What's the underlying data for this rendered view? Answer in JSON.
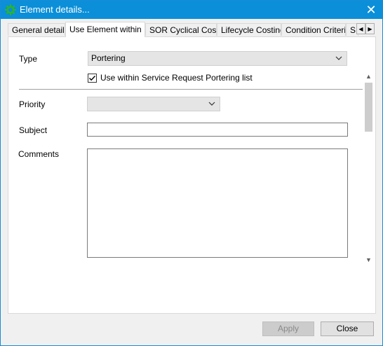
{
  "window": {
    "title": "Element details...",
    "close_glyph": "✕"
  },
  "tabs": [
    {
      "label": "General details",
      "active": false
    },
    {
      "label": "Use Element within ..",
      "active": true
    },
    {
      "label": "SOR Cyclical Costs",
      "active": false
    },
    {
      "label": "Lifecycle Costing",
      "active": false
    },
    {
      "label": "Condition Criteria",
      "active": false
    },
    {
      "label": "S",
      "active": false
    }
  ],
  "tab_scroll": {
    "left_glyph": "◀",
    "right_glyph": "▶"
  },
  "form": {
    "type_label": "Type",
    "type_value": "Portering",
    "checkbox_label": "Use within Service Request Portering list",
    "checkbox_checked": true,
    "priority_label": "Priority",
    "priority_value": "",
    "subject_label": "Subject",
    "subject_value": "",
    "comments_label": "Comments",
    "comments_value": ""
  },
  "scrollbar": {
    "up_glyph": "▲",
    "down_glyph": "▼"
  },
  "buttons": {
    "apply_label": "Apply",
    "apply_enabled": false,
    "close_label": "Close"
  },
  "icons": {
    "title_icon": "element-gear-icon",
    "close_icon": "close-icon",
    "dropdown_icon": "chevron-down-icon",
    "check_icon": "checkmark-icon"
  },
  "colors": {
    "titlebar": "#0b8fd8",
    "icon_green": "#2bb52b",
    "disabled_button": "#cccccc"
  }
}
